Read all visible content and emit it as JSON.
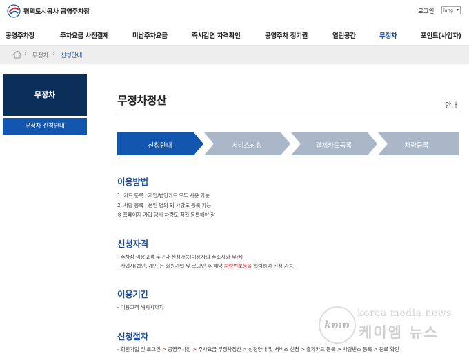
{
  "header": {
    "logo_text": "평택도시공사 공영주차장",
    "login_label": "로그인",
    "lang_label": "lang"
  },
  "gnb": {
    "items": [
      {
        "label": "공영주차장"
      },
      {
        "label": "주차요금 사전결제"
      },
      {
        "label": "미납주차요금"
      },
      {
        "label": "즉시감면 자격확인"
      },
      {
        "label": "공영주차 정기권"
      },
      {
        "label": "열린공간"
      },
      {
        "label": "무정차",
        "active": true
      },
      {
        "label": "포인트(사업자)"
      }
    ]
  },
  "breadcrumb": {
    "items": [
      "무정차",
      "신청안내"
    ]
  },
  "sidebar": {
    "title": "무정차",
    "items": [
      {
        "label": "무정차 신청안내",
        "active": true
      }
    ]
  },
  "page": {
    "title": "무정차정산",
    "subtitle": "안내"
  },
  "steps": [
    {
      "label": "신청안내",
      "active": true
    },
    {
      "label": "서비스신청"
    },
    {
      "label": "결제카드등록"
    },
    {
      "label": "차량등록"
    }
  ],
  "sections": {
    "usage": {
      "title": "이용방법",
      "lines": [
        "1. 카드 등록 : 개인/법인카드 모두 사용 가능",
        "2. 차량 등록 : 본인 명의 외 차량도 등록 가능",
        "※ 홈페이지 가입 당시 차량도 직접 등록해야 함"
      ]
    },
    "eligibility": {
      "title": "신청자격",
      "line1": "- 주차장 이용고객 누구나 신청가능(이용자의 주소지와 무관)",
      "line2_a": "- 사업자(법인, 개인)는 회원가입 및 로그인 후 해당 ",
      "line2_red": "차량번호등을",
      "line2_b": " 입력하여 신청 가능"
    },
    "period": {
      "title": "이용기간",
      "line": "- 이용고객 해지시까지"
    },
    "procedure": {
      "title": "신청절차",
      "p1": "- 회원가입 및 로그인",
      "arrow": ">",
      "p2": "공영주차장",
      "p3": "주차요금 무정차정산 > 신청안내 및 서비스 신청 > 결제카드 등록 > 차량번호 등록 > 완료 확인"
    }
  },
  "watermark": {
    "logo": "kmn",
    "en": "korea media news",
    "ko": "케이엠 뉴스"
  },
  "colors": {
    "navy": "#0c2f5a",
    "blue": "#1256b0",
    "step_active": "#1256b0",
    "step_inactive": "#a9b7c8",
    "section_title": "#1d4f98",
    "accent_red": "#dd2222"
  }
}
